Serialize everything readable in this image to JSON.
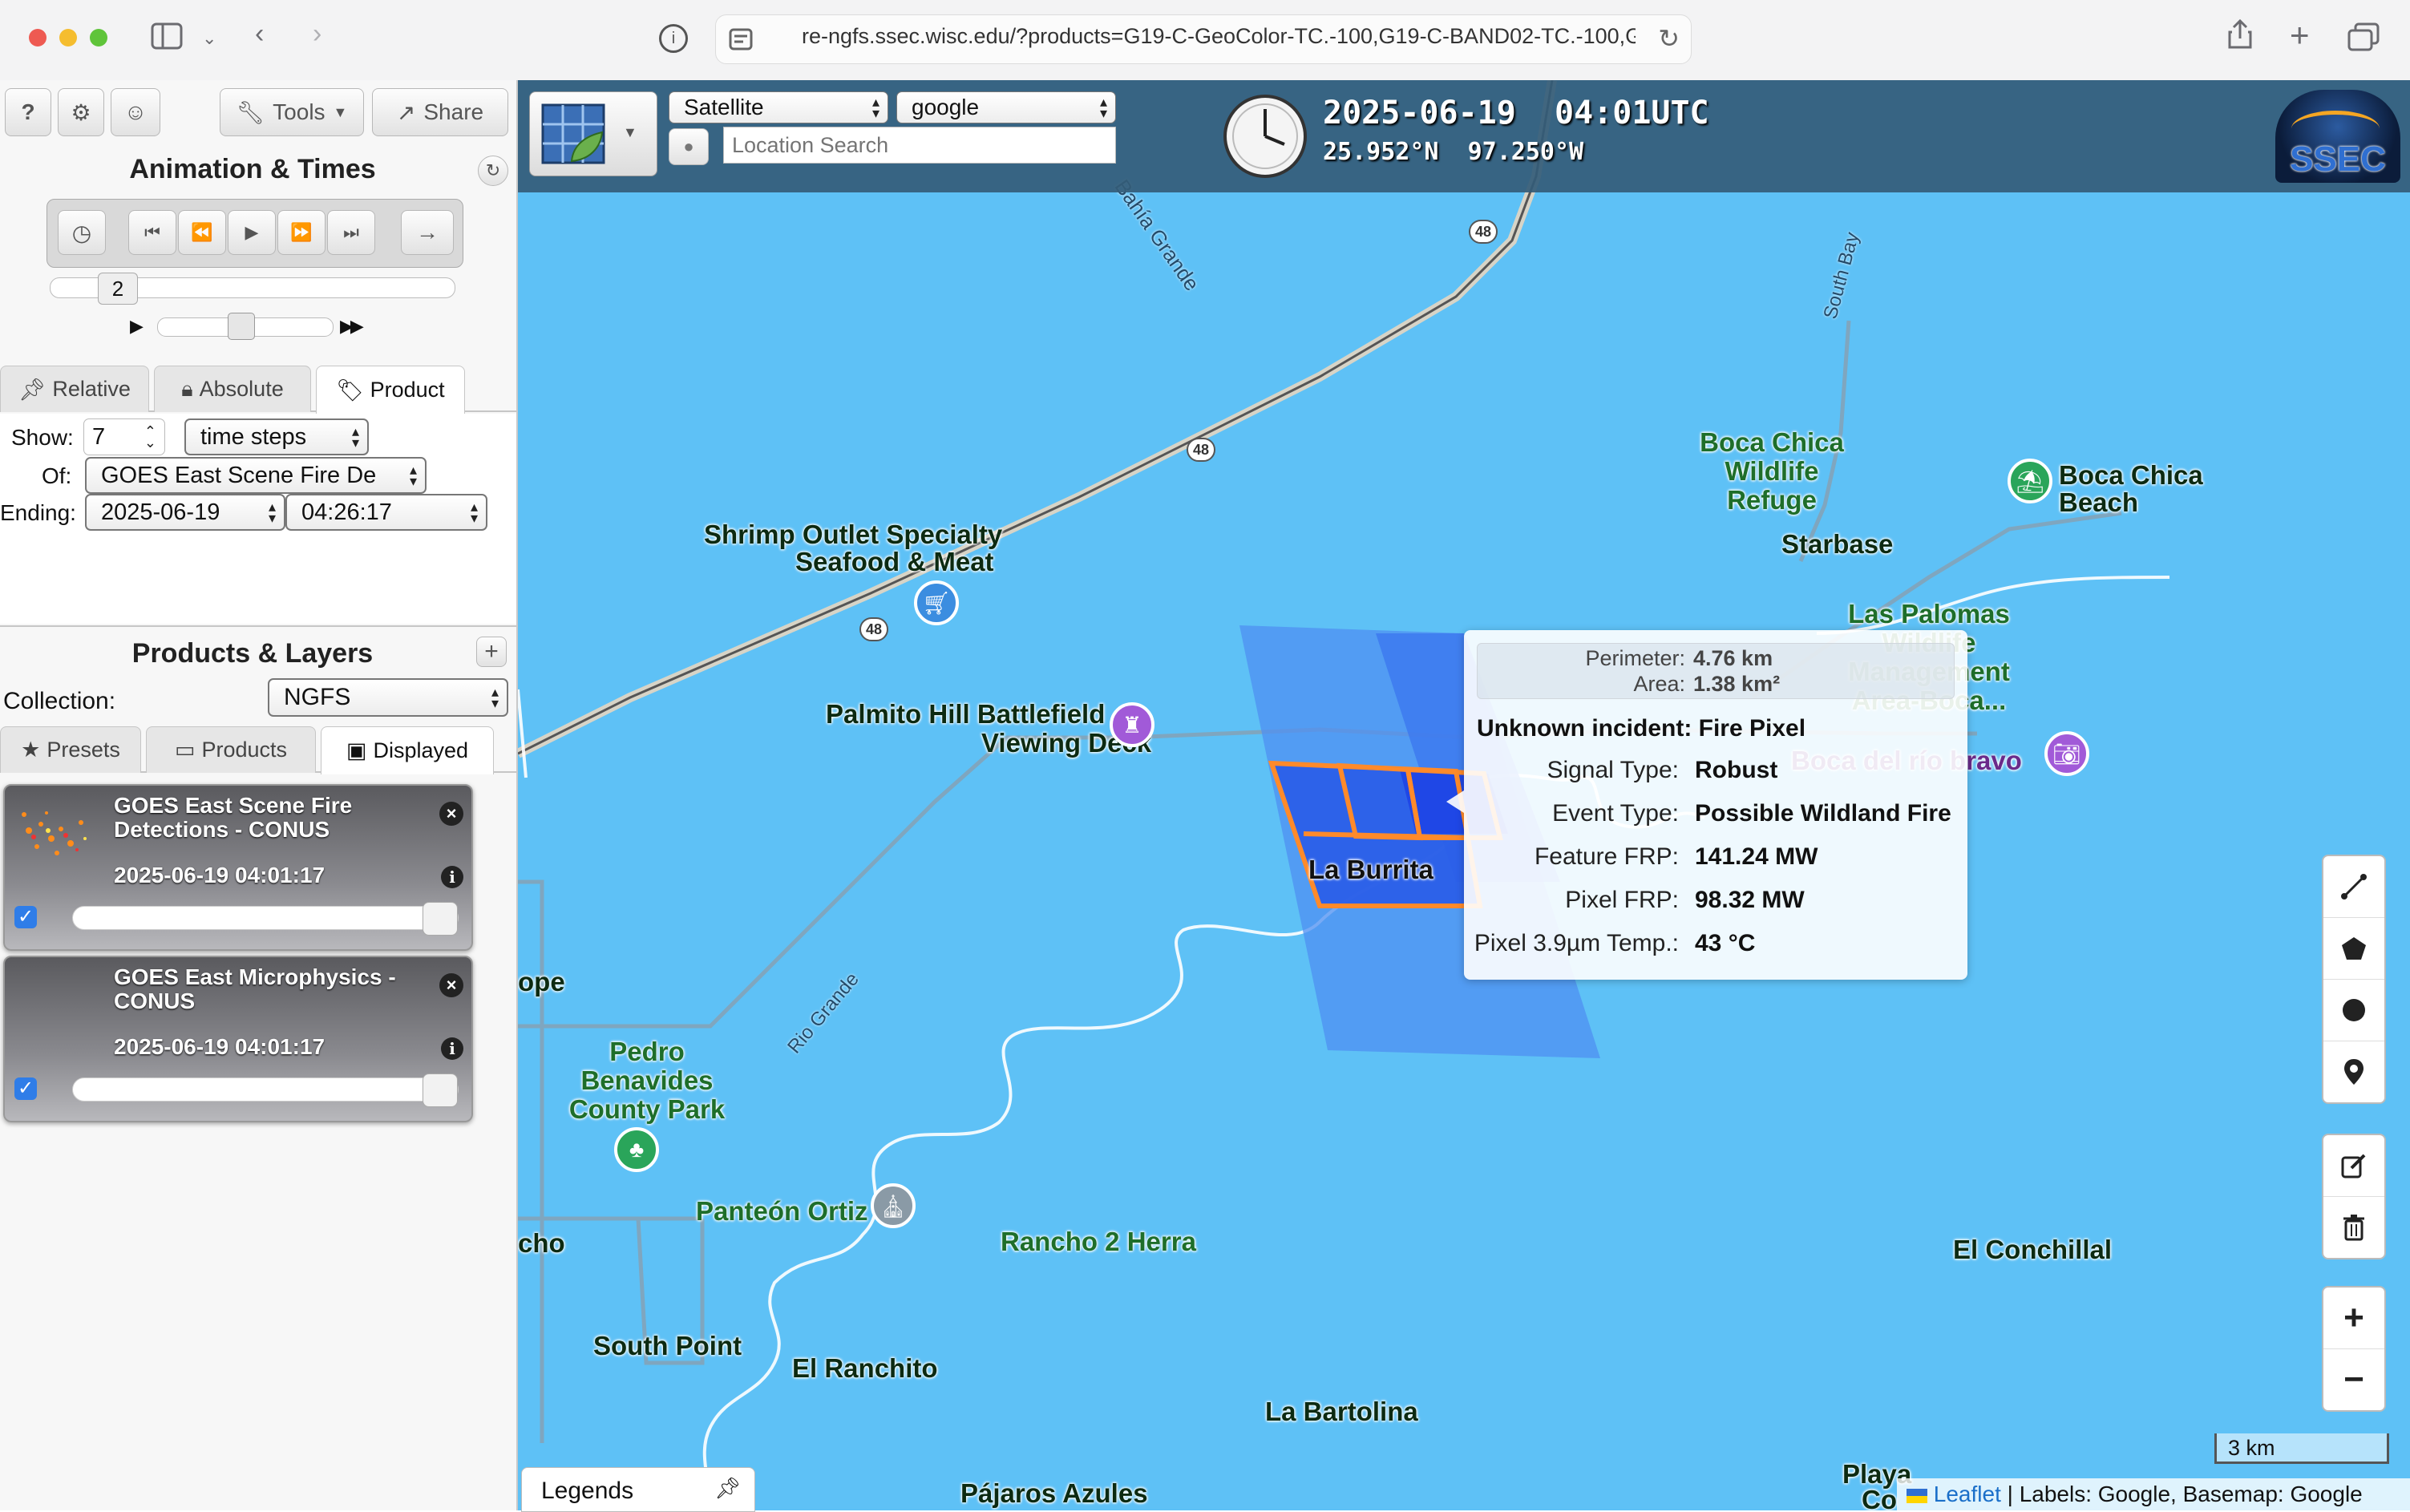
{
  "browser": {
    "url": "re-ngfs.ssec.wisc.edu/?products=G19-C-GeoColor-TC.-100,G19-C-BAND02-TC.-100,G"
  },
  "toolbar": {
    "help_label": "?",
    "tools_label": "Tools",
    "share_label": "Share"
  },
  "animation": {
    "title": "Animation & Times",
    "speed_value": "2",
    "tabs": [
      "Relative",
      "Absolute",
      "Product"
    ],
    "show_label": "Show:",
    "show_value": "7",
    "show_unit": "time steps",
    "of_label": "Of:",
    "of_value": "GOES East Scene Fire De",
    "ending_label": "Ending:",
    "ending_date": "2025-06-19",
    "ending_time": "04:26:17"
  },
  "products": {
    "title": "Products & Layers",
    "collection_label": "Collection:",
    "collection_value": "NGFS",
    "tabs": [
      "Presets",
      "Products",
      "Displayed"
    ],
    "layers": [
      {
        "title_line1": "GOES East Scene Fire",
        "title_line2": "Detections - CONUS",
        "time": "2025-06-19 04:01:17",
        "checked": true,
        "opacity": 1.0
      },
      {
        "title_line1": "GOES East Microphysics -",
        "title_line2": "CONUS",
        "time": "2025-06-19 04:01:17",
        "checked": true,
        "opacity": 1.0
      }
    ]
  },
  "map": {
    "basemap_select": "Satellite",
    "label_select": "google",
    "search_placeholder": "Location Search",
    "datetime": "2025-06-19  04:01UTC",
    "coords": "25.952°N  97.250°W",
    "logo": "SSEC",
    "labels": {
      "bahia": "Bahía Grande",
      "south_bay": "South Bay",
      "shrimp1": "Shrimp Outlet Specialty",
      "shrimp2": "Seafood & Meat",
      "palmito1": "Palmito Hill Battlefield",
      "palmito2": "Viewing Deck",
      "boca_refuge1": "Boca Chica",
      "boca_refuge2": "Wildlife",
      "boca_refuge3": "Refuge",
      "boca_beach1": "Boca Chica",
      "boca_beach2": "Beach",
      "starbase": "Starbase",
      "las_palomas1": "Las Palomas",
      "las_palomas2": "Wildlife",
      "las_palomas3": "Management",
      "las_palomas4": "Area-Boca...",
      "boca_rio": "Boca del río bravo",
      "la_burrita": "La Burrita",
      "rio_grande": "Rio Grande",
      "pedro1": "Pedro",
      "pedro2": "Benavides",
      "pedro3": "County Park",
      "panteon": "Panteón Ortiz",
      "rancho2": "Rancho 2 Herra",
      "el_conchillal": "El Conchillal",
      "south_point": "South Point",
      "el_ranchito": "El Ranchito",
      "la_bartolina": "La Bartolina",
      "pajaros": "Pájaros Azules",
      "ope": "ope",
      "cho": "cho",
      "playa": "Playa",
      "co": "Co"
    },
    "road_shields": [
      "48",
      "48",
      "48"
    ],
    "scale": "3 km",
    "attribution_leaflet": "Leaflet",
    "attribution_rest": " | Labels: Google, Basemap: Google",
    "legends_label": "Legends"
  },
  "popup": {
    "perimeter_label": "Perimeter:",
    "perimeter_value": "4.76 km",
    "area_label": "Area:",
    "area_value": "1.38 km²",
    "incident": "Unknown incident: Fire Pixel",
    "rows": [
      {
        "label": "Signal Type:",
        "value": "Robust"
      },
      {
        "label": "Event Type:",
        "value": "Possible Wildland Fire"
      },
      {
        "label": "Feature FRP:",
        "value": "141.24 MW"
      },
      {
        "label": "Pixel FRP:",
        "value": "98.32 MW"
      },
      {
        "label": "Pixel 3.9µm Temp.:",
        "value": "43 °C"
      }
    ]
  }
}
